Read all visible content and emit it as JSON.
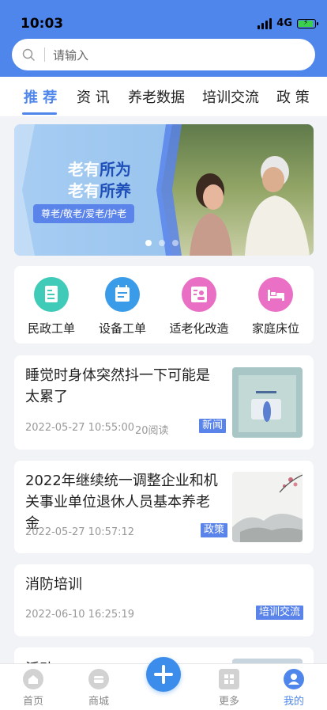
{
  "status": {
    "time": "10:03",
    "network": "4G"
  },
  "search": {
    "placeholder": "请输入"
  },
  "tabs": [
    {
      "label": "推 荐",
      "active": true
    },
    {
      "label": "资 讯"
    },
    {
      "label": "养老数据"
    },
    {
      "label": "培训交流"
    },
    {
      "label": "政 策"
    }
  ],
  "banner": {
    "line1_a": "老有",
    "line1_b": "所为",
    "line2_a": "老有",
    "line2_b": "所养",
    "tag": "尊老/敬老/爱老/护老",
    "slides": 3,
    "active_slide": 1
  },
  "quick": [
    {
      "label": "民政工单",
      "icon": "document-icon",
      "color": "#3fcbb7"
    },
    {
      "label": "设备工单",
      "icon": "calendar-icon",
      "color": "#3a9be8"
    },
    {
      "label": "适老化改造",
      "icon": "id-card-icon",
      "color": "#e86fc4"
    },
    {
      "label": "家庭床位",
      "icon": "bed-icon",
      "color": "#ea70c5"
    }
  ],
  "articles": [
    {
      "title": "睡觉时身体突然抖一下可能是太累了",
      "date": "2022-05-27 10:55:00",
      "reads": "20阅读",
      "tag": "新闻"
    },
    {
      "title": "2022年继续统一调整企业和机关事业单位退休人员基本养老金",
      "date": "2022-05-27 10:57:12",
      "tag": "政策"
    },
    {
      "title": "消防培训",
      "date": "2022-06-10 16:25:19",
      "tag": "培训交流"
    },
    {
      "title": "活动"
    }
  ],
  "nav": [
    {
      "label": "首页",
      "icon": "home-icon"
    },
    {
      "label": "商城",
      "icon": "shop-icon"
    },
    {
      "label": "",
      "icon": "plus-icon"
    },
    {
      "label": "更多",
      "icon": "grid-icon"
    },
    {
      "label": "我的",
      "icon": "user-icon",
      "active": true
    }
  ],
  "colors": {
    "primary": "#4f86ec",
    "tag_bg": "#5a84ea"
  }
}
